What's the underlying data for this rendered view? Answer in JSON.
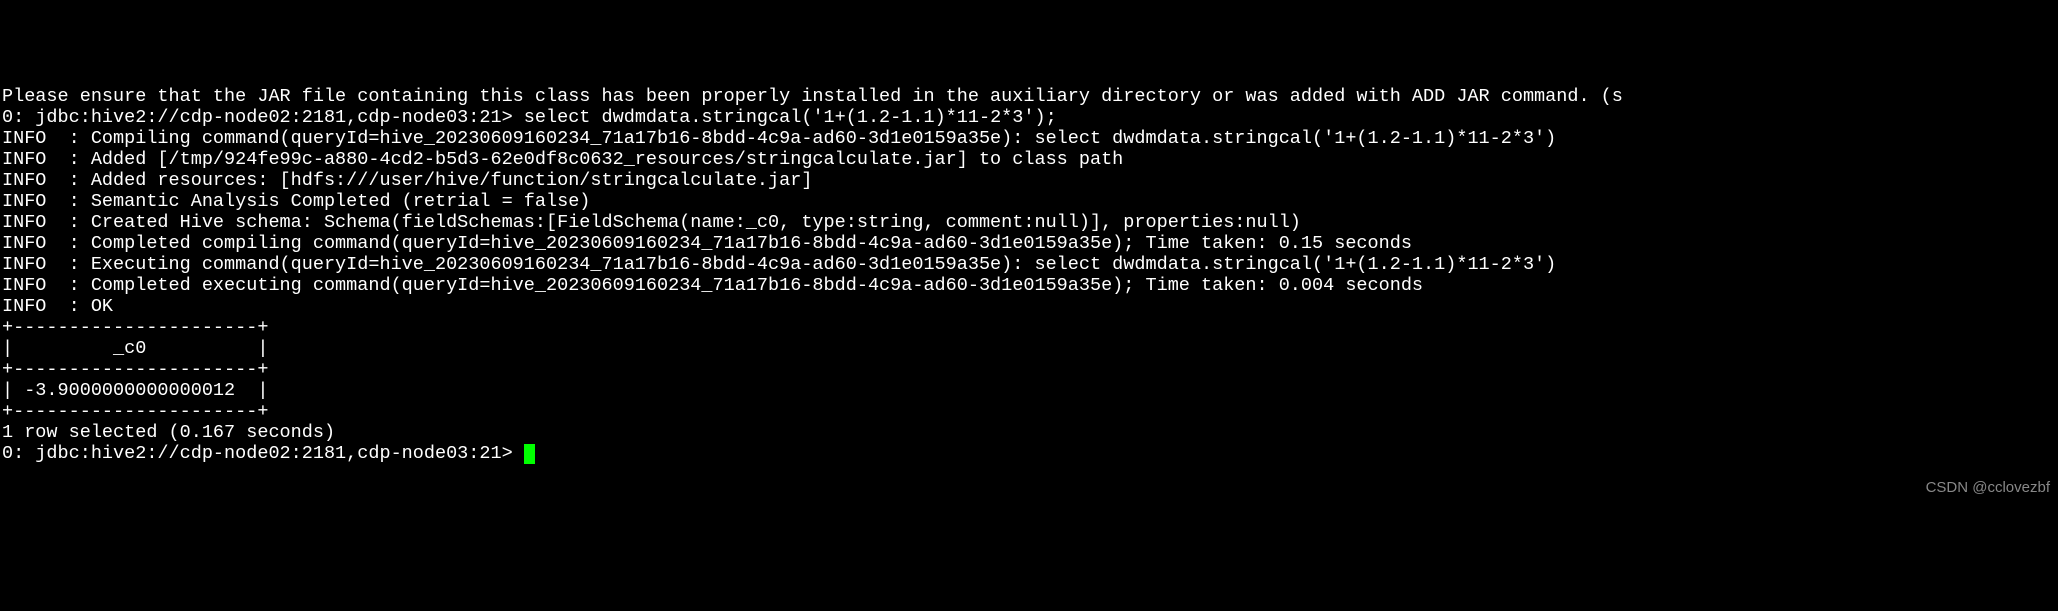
{
  "top_cut": "Please ensure that the JAR file containing this class has been properly installed in the auxiliary directory or was added with ADD JAR command. (s",
  "prompt1": "0: jdbc:hive2://cdp-node02:2181,cdp-node03:21> ",
  "command1": "select dwdmdata.stringcal('1+(1.2-1.1)*11-2*3');",
  "logs": [
    "INFO  : Compiling command(queryId=hive_20230609160234_71a17b16-8bdd-4c9a-ad60-3d1e0159a35e): select dwdmdata.stringcal('1+(1.2-1.1)*11-2*3')",
    "INFO  : Added [/tmp/924fe99c-a880-4cd2-b5d3-62e0df8c0632_resources/stringcalculate.jar] to class path",
    "INFO  : Added resources: [hdfs:///user/hive/function/stringcalculate.jar]",
    "INFO  : Semantic Analysis Completed (retrial = false)",
    "INFO  : Created Hive schema: Schema(fieldSchemas:[FieldSchema(name:_c0, type:string, comment:null)], properties:null)",
    "INFO  : Completed compiling command(queryId=hive_20230609160234_71a17b16-8bdd-4c9a-ad60-3d1e0159a35e); Time taken: 0.15 seconds",
    "INFO  : Executing command(queryId=hive_20230609160234_71a17b16-8bdd-4c9a-ad60-3d1e0159a35e): select dwdmdata.stringcal('1+(1.2-1.1)*11-2*3')",
    "INFO  : Completed executing command(queryId=hive_20230609160234_71a17b16-8bdd-4c9a-ad60-3d1e0159a35e); Time taken: 0.004 seconds",
    "INFO  : OK"
  ],
  "table": {
    "sep": "+----------------------+",
    "header": "|         _c0          |",
    "row": "| -3.9000000000000012  |"
  },
  "footer": "1 row selected (0.167 seconds)",
  "prompt2": "0: jdbc:hive2://cdp-node02:2181,cdp-node03:21> ",
  "watermark": "CSDN @cclovezbf"
}
